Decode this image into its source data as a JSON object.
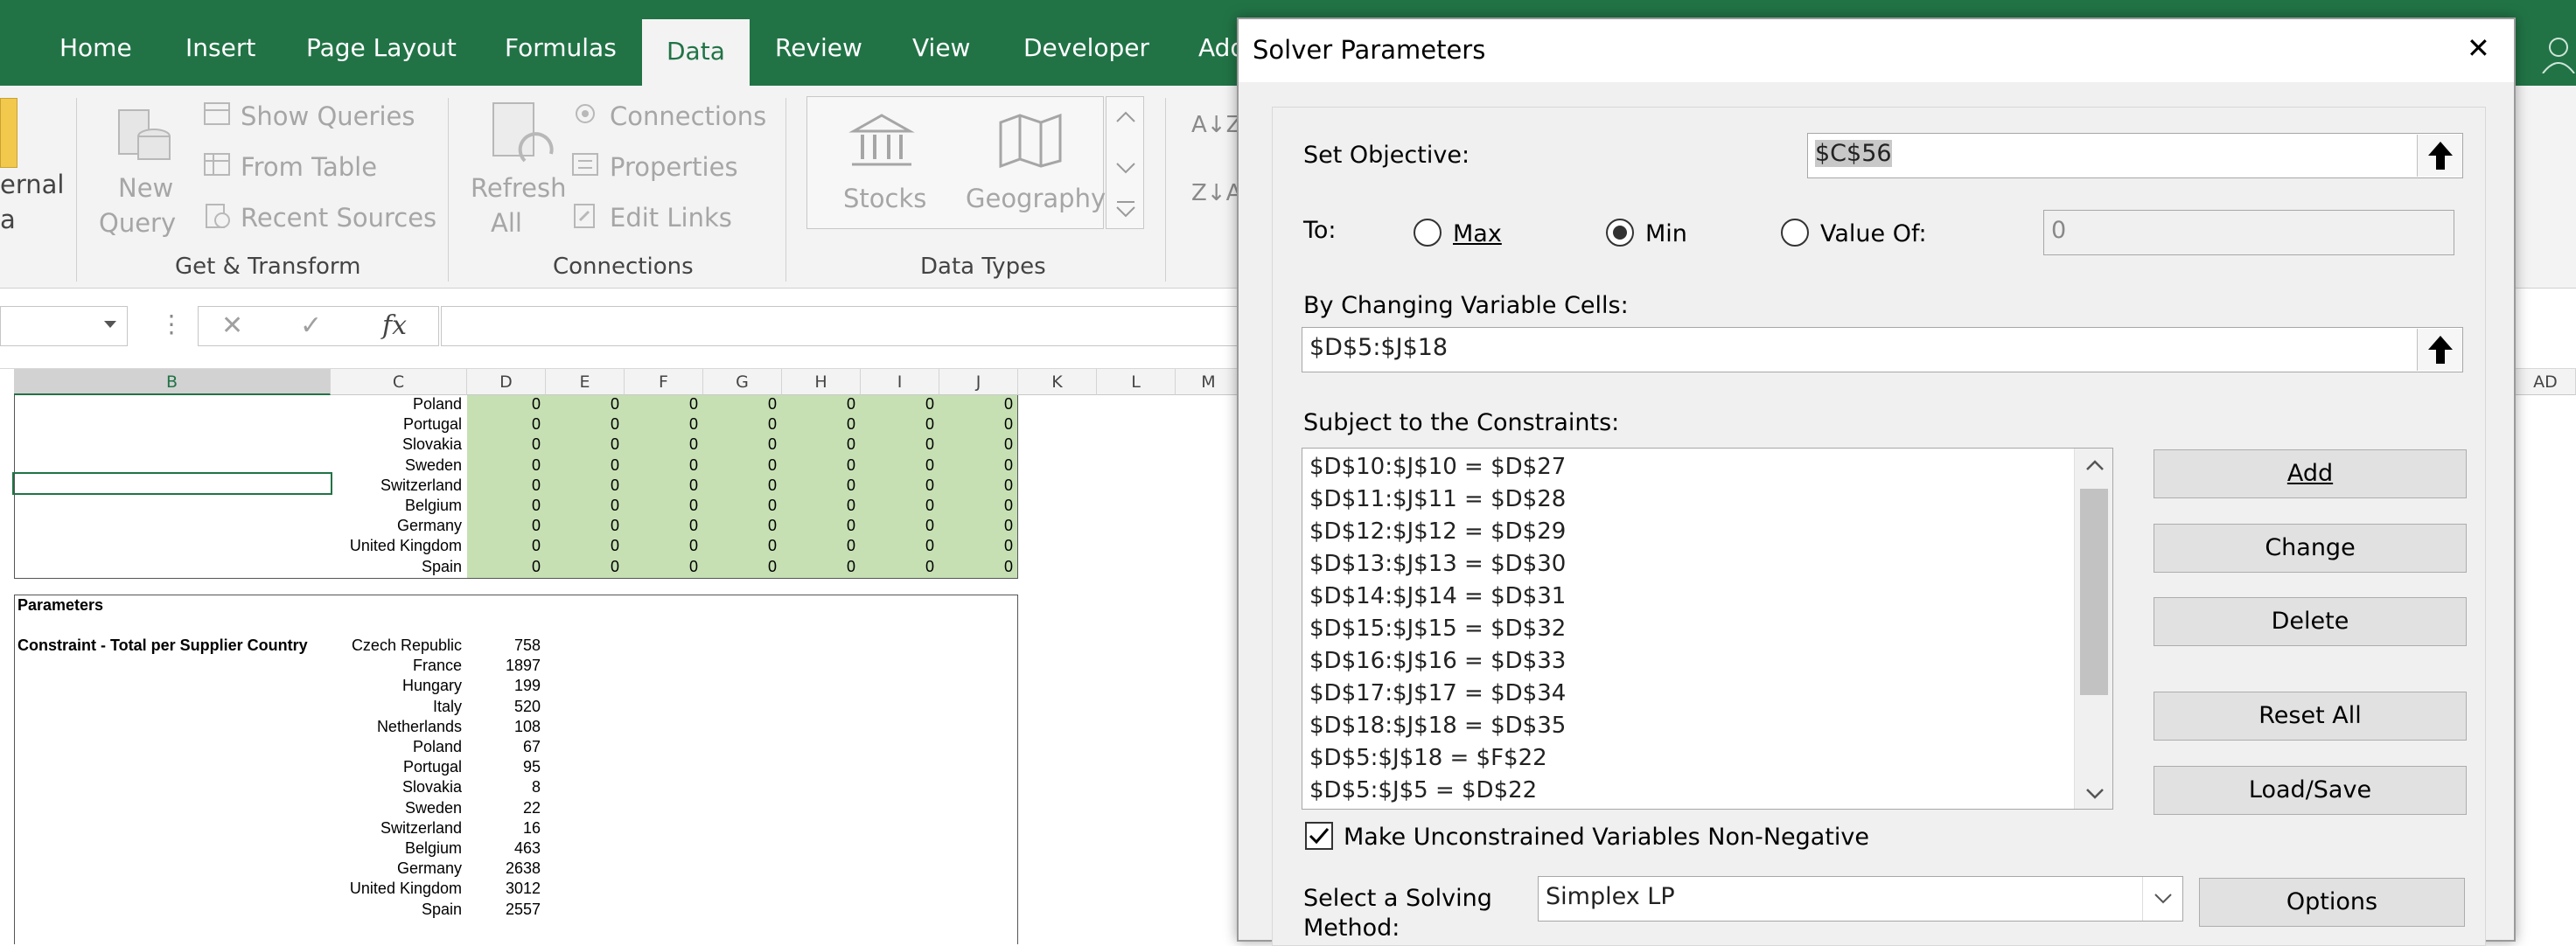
{
  "ribbon": {
    "tabs": [
      "Home",
      "Insert",
      "Page Layout",
      "Formulas",
      "Data",
      "Review",
      "View",
      "Developer",
      "Add"
    ],
    "active_tab": "Data",
    "cut_text": [
      "ernal",
      "a"
    ],
    "new_query": [
      "New",
      "Query"
    ],
    "show_queries": "Show Queries",
    "from_table": "From Table",
    "recent_sources": "Recent Sources",
    "refresh_all": [
      "Refresh",
      "All"
    ],
    "connections": "Connections",
    "properties": "Properties",
    "edit_links": "Edit Links",
    "stocks": "Stocks",
    "geography": "Geography",
    "group_labels": [
      "Get & Transform",
      "Connections",
      "Data Types"
    ]
  },
  "formula_bar": {
    "fx": "fx",
    "cancel": "✕",
    "enter": "✓"
  },
  "sheet": {
    "columns": [
      "B",
      "C",
      "D",
      "E",
      "F",
      "G",
      "H",
      "I",
      "J",
      "K",
      "L",
      "M",
      "AD"
    ],
    "selected_column": "B",
    "top_rows": [
      {
        "label": "Poland",
        "values": [
          "0",
          "0",
          "0",
          "0",
          "0",
          "0",
          "0"
        ]
      },
      {
        "label": "Portugal",
        "values": [
          "0",
          "0",
          "0",
          "0",
          "0",
          "0",
          "0"
        ]
      },
      {
        "label": "Slovakia",
        "values": [
          "0",
          "0",
          "0",
          "0",
          "0",
          "0",
          "0"
        ]
      },
      {
        "label": "Sweden",
        "values": [
          "0",
          "0",
          "0",
          "0",
          "0",
          "0",
          "0"
        ]
      },
      {
        "label": "Switzerland",
        "values": [
          "0",
          "0",
          "0",
          "0",
          "0",
          "0",
          "0"
        ]
      },
      {
        "label": "Belgium",
        "values": [
          "0",
          "0",
          "0",
          "0",
          "0",
          "0",
          "0"
        ]
      },
      {
        "label": "Germany",
        "values": [
          "0",
          "0",
          "0",
          "0",
          "0",
          "0",
          "0"
        ]
      },
      {
        "label": "United Kingdom",
        "values": [
          "0",
          "0",
          "0",
          "0",
          "0",
          "0",
          "0"
        ]
      },
      {
        "label": "Spain",
        "values": [
          "0",
          "0",
          "0",
          "0",
          "0",
          "0",
          "0"
        ]
      }
    ],
    "parameters_label": "Parameters",
    "constraint_label": "Constraint - Total per Supplier Country",
    "param_rows": [
      {
        "label": "Czech Republic",
        "value": "758"
      },
      {
        "label": "France",
        "value": "1897"
      },
      {
        "label": "Hungary",
        "value": "199"
      },
      {
        "label": "Italy",
        "value": "520"
      },
      {
        "label": "Netherlands",
        "value": "108"
      },
      {
        "label": "Poland",
        "value": "67"
      },
      {
        "label": "Portugal",
        "value": "95"
      },
      {
        "label": "Slovakia",
        "value": "8"
      },
      {
        "label": "Sweden",
        "value": "22"
      },
      {
        "label": "Switzerland",
        "value": "16"
      },
      {
        "label": "Belgium",
        "value": "463"
      },
      {
        "label": "Germany",
        "value": "2638"
      },
      {
        "label": "United Kingdom",
        "value": "3012"
      },
      {
        "label": "Spain",
        "value": "2557"
      }
    ]
  },
  "solver": {
    "title": "Solver Parameters",
    "close": "✕",
    "set_objective_label": "Set Objective:",
    "set_objective_value": "$C$56",
    "to_label": "To:",
    "max_label": "Max",
    "min_label": "Min",
    "value_of_label": "Value Of:",
    "value_of_value": "0",
    "selected": "Min",
    "changing_label": "By Changing Variable Cells:",
    "changing_value": "$D$5:$J$18",
    "constraints_label": "Subject to the Constraints:",
    "constraints": [
      "$D$10:$J$10 = $D$27",
      "$D$11:$J$11 = $D$28",
      "$D$12:$J$12 = $D$29",
      "$D$13:$J$13 = $D$30",
      "$D$14:$J$14 = $D$31",
      "$D$15:$J$15 = $D$32",
      "$D$16:$J$16 = $D$33",
      "$D$17:$J$17 = $D$34",
      "$D$18:$J$18 = $D$35",
      "$D$5:$J$18 = $F$22",
      "$D$5:$J$5 = $D$22"
    ],
    "add": "Add",
    "change": "Change",
    "delete": "Delete",
    "reset_all": "Reset All",
    "load_save": "Load/Save",
    "nonneg_label": "Make Unconstrained Variables Non-Negative",
    "nonneg_checked": true,
    "method_label": [
      "Select a Solving",
      "Method:"
    ],
    "method_value": "Simplex LP",
    "options": "Options"
  }
}
